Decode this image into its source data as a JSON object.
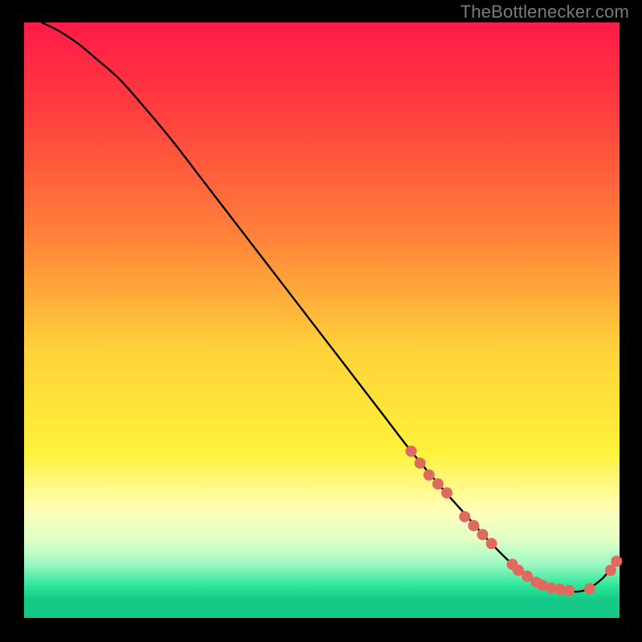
{
  "attribution": "TheBottlenecker.com",
  "chart_data": {
    "type": "line",
    "title": "",
    "xlabel": "",
    "ylabel": "",
    "xlim": [
      0,
      100
    ],
    "ylim": [
      0,
      100
    ],
    "grid": false,
    "background_gradient": {
      "stops": [
        {
          "offset": 0.0,
          "color": "#ff1a49"
        },
        {
          "offset": 0.15,
          "color": "#ff3e3e"
        },
        {
          "offset": 0.35,
          "color": "#ff7f3a"
        },
        {
          "offset": 0.55,
          "color": "#ffd23a"
        },
        {
          "offset": 0.72,
          "color": "#fff13a"
        },
        {
          "offset": 0.82,
          "color": "#ffffba"
        },
        {
          "offset": 0.87,
          "color": "#dfffc7"
        },
        {
          "offset": 0.91,
          "color": "#9cf7c1"
        },
        {
          "offset": 0.945,
          "color": "#2fe79b"
        },
        {
          "offset": 0.97,
          "color": "#14c987"
        }
      ]
    },
    "series": [
      {
        "name": "bottleneck-curve",
        "color": "#000000",
        "x": [
          3,
          6,
          9,
          12,
          16,
          20,
          25,
          30,
          35,
          40,
          45,
          50,
          55,
          60,
          65,
          70,
          74,
          78,
          82,
          85,
          88,
          91,
          94,
          97,
          99
        ],
        "y": [
          100,
          98.5,
          96.5,
          94,
          90.5,
          86,
          80,
          73.5,
          67,
          60.5,
          54,
          47.5,
          41,
          34.5,
          28,
          22,
          17.5,
          13,
          9,
          6.5,
          5,
          4.5,
          4.6,
          6.5,
          9
        ]
      }
    ],
    "markers": {
      "name": "data-points",
      "color": "#e06a5d",
      "radius_px": 7,
      "points": [
        {
          "x": 65,
          "y": 28
        },
        {
          "x": 66.5,
          "y": 26
        },
        {
          "x": 68,
          "y": 24
        },
        {
          "x": 69.5,
          "y": 22.5
        },
        {
          "x": 71,
          "y": 21
        },
        {
          "x": 74,
          "y": 17
        },
        {
          "x": 75.5,
          "y": 15.5
        },
        {
          "x": 77,
          "y": 14
        },
        {
          "x": 78.5,
          "y": 12.5
        },
        {
          "x": 82,
          "y": 9
        },
        {
          "x": 83,
          "y": 8
        },
        {
          "x": 84.5,
          "y": 7
        },
        {
          "x": 86,
          "y": 6
        },
        {
          "x": 87,
          "y": 5.5
        },
        {
          "x": 88.5,
          "y": 5
        },
        {
          "x": 90,
          "y": 4.8
        },
        {
          "x": 91.5,
          "y": 4.6
        },
        {
          "x": 95,
          "y": 4.9
        },
        {
          "x": 98.5,
          "y": 8
        },
        {
          "x": 99.5,
          "y": 9.5
        }
      ]
    }
  }
}
